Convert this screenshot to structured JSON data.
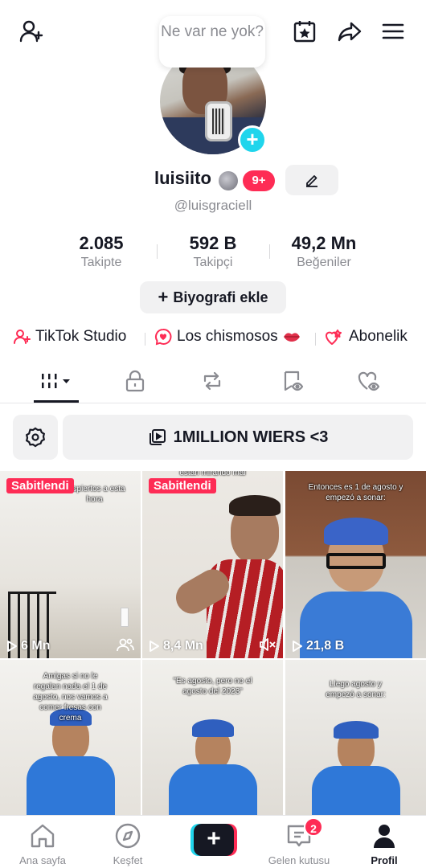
{
  "header": {
    "bubble_text": "Ne var ne yok?"
  },
  "profile": {
    "username": "luisiito",
    "notification_count": "9+",
    "handle": "@luisgraciell",
    "stats": [
      {
        "value": "2.085",
        "label": "Takipte"
      },
      {
        "value": "592 B",
        "label": "Takipçi"
      },
      {
        "value": "49,2 Mn",
        "label": "Beğeniler"
      }
    ],
    "bio_button": "Biyografi ekle"
  },
  "links": [
    {
      "label": "TikTok Studio",
      "icon": "user-plus-icon"
    },
    {
      "label": "Los chismosos",
      "icon": "chat-heart-icon"
    },
    {
      "label": "Abonelik",
      "icon": "hearts-icon"
    }
  ],
  "collection": {
    "label": "1MILLION WIERS <3"
  },
  "videos": [
    {
      "caption": "despiertos a esta hora",
      "pinned": "Sabitlendi",
      "views": "6 Mn",
      "extra_icon": "friends-icon"
    },
    {
      "caption": "estan mirando mal",
      "pinned": "Sabitlendi",
      "views": "8,4 Mn",
      "extra_icon": "mute-icon"
    },
    {
      "caption": "Entonces es 1 de agosto y empezó a sonar:",
      "pinned": "",
      "views": "21,8 B",
      "extra_icon": ""
    },
    {
      "caption": "Amigas si no le regalan nada el 1 de agosto, nos vamos a comer fresas con crema",
      "pinned": "",
      "views": "",
      "extra_icon": ""
    },
    {
      "caption": "\"Es agosto, pero no el agosto del 2023\"",
      "pinned": "",
      "views": "",
      "extra_icon": ""
    },
    {
      "caption": "Llego agosto y empezó a sonar:",
      "pinned": "",
      "views": "",
      "extra_icon": ""
    }
  ],
  "bottom_nav": {
    "home": "Ana sayfa",
    "discover": "Keşfet",
    "inbox": "Gelen kutusu",
    "inbox_badge": "2",
    "profile": "Profil"
  },
  "colors": {
    "accent_red": "#fe2c55",
    "accent_cyan": "#20d5ec",
    "text_primary": "#161823",
    "text_secondary": "#8a8b91"
  }
}
